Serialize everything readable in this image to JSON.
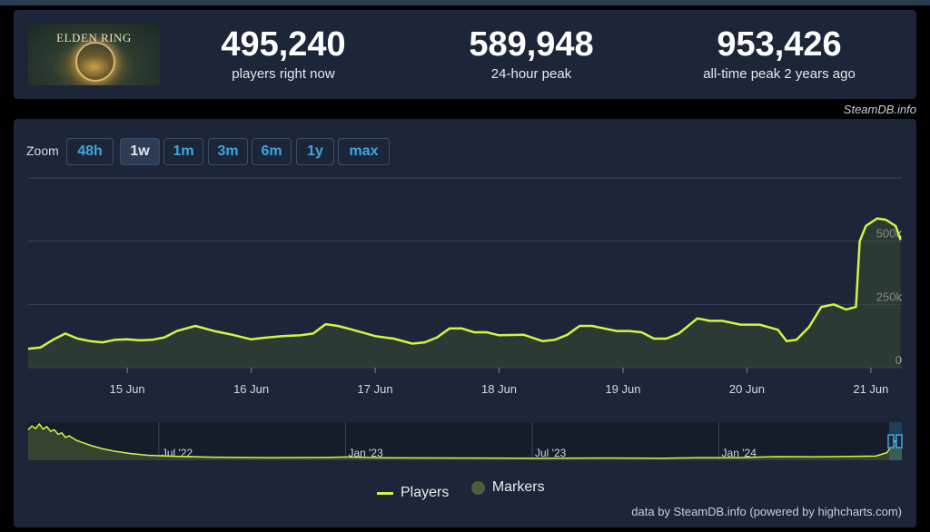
{
  "stats": {
    "current": {
      "value": "495,240",
      "label": "players right now"
    },
    "peak24": {
      "value": "589,948",
      "label": "24-hour peak"
    },
    "alltime": {
      "value": "953,426",
      "label": "all-time peak 2 years ago"
    }
  },
  "logo_text": "ELDEN RING",
  "credit_top": "SteamDB.info",
  "zoom": {
    "label": "Zoom",
    "options": [
      "48h",
      "1w",
      "1m",
      "3m",
      "6m",
      "1y",
      "max"
    ],
    "active": "1w"
  },
  "legend": {
    "players": "Players",
    "markers": "Markers"
  },
  "credit_bottom": "data by SteamDB.info (powered by highcharts.com)",
  "colors": {
    "line": "#d1f545",
    "card": "#1c2638",
    "accent": "#3ea6e0",
    "grid": "#36445a"
  },
  "chart_data": {
    "type": "area",
    "series": [
      {
        "name": "Players",
        "unit": "players"
      }
    ],
    "y_ticks": [
      "0",
      "250k",
      "500k"
    ],
    "y_values": [
      0,
      250000,
      500000
    ],
    "ylim": [
      0,
      750000
    ],
    "x_labels": [
      "15 Jun",
      "16 Jun",
      "17 Jun",
      "18 Jun",
      "19 Jun",
      "20 Jun",
      "21 Jun"
    ],
    "x_label_days": [
      15,
      16,
      17,
      18,
      19,
      20,
      21
    ],
    "xlim_days": [
      14.2,
      21.25
    ],
    "points": [
      [
        14.2,
        75000
      ],
      [
        14.3,
        80000
      ],
      [
        14.4,
        110000
      ],
      [
        14.5,
        135000
      ],
      [
        14.6,
        115000
      ],
      [
        14.7,
        105000
      ],
      [
        14.8,
        100000
      ],
      [
        14.9,
        110000
      ],
      [
        15.0,
        112000
      ],
      [
        15.1,
        108000
      ],
      [
        15.2,
        110000
      ],
      [
        15.3,
        120000
      ],
      [
        15.4,
        145000
      ],
      [
        15.55,
        165000
      ],
      [
        15.7,
        145000
      ],
      [
        15.85,
        130000
      ],
      [
        16.0,
        112000
      ],
      [
        16.1,
        118000
      ],
      [
        16.25,
        125000
      ],
      [
        16.4,
        128000
      ],
      [
        16.5,
        135000
      ],
      [
        16.6,
        172000
      ],
      [
        16.7,
        165000
      ],
      [
        16.8,
        152000
      ],
      [
        17.0,
        125000
      ],
      [
        17.15,
        115000
      ],
      [
        17.3,
        95000
      ],
      [
        17.4,
        100000
      ],
      [
        17.5,
        120000
      ],
      [
        17.6,
        155000
      ],
      [
        17.7,
        155000
      ],
      [
        17.8,
        140000
      ],
      [
        17.9,
        140000
      ],
      [
        18.0,
        128000
      ],
      [
        18.2,
        130000
      ],
      [
        18.35,
        105000
      ],
      [
        18.45,
        110000
      ],
      [
        18.55,
        130000
      ],
      [
        18.65,
        165000
      ],
      [
        18.75,
        165000
      ],
      [
        18.85,
        155000
      ],
      [
        18.95,
        145000
      ],
      [
        19.05,
        145000
      ],
      [
        19.15,
        140000
      ],
      [
        19.25,
        115000
      ],
      [
        19.35,
        115000
      ],
      [
        19.45,
        135000
      ],
      [
        19.6,
        195000
      ],
      [
        19.7,
        185000
      ],
      [
        19.8,
        185000
      ],
      [
        19.95,
        170000
      ],
      [
        20.1,
        170000
      ],
      [
        20.25,
        150000
      ],
      [
        20.32,
        105000
      ],
      [
        20.4,
        110000
      ],
      [
        20.5,
        160000
      ],
      [
        20.6,
        240000
      ],
      [
        20.7,
        250000
      ],
      [
        20.8,
        230000
      ],
      [
        20.88,
        240000
      ],
      [
        20.91,
        500000
      ],
      [
        20.96,
        560000
      ],
      [
        21.05,
        590000
      ],
      [
        21.12,
        585000
      ],
      [
        21.2,
        560000
      ],
      [
        21.24,
        505000
      ]
    ]
  },
  "navigator": {
    "labels": [
      "Jul '22",
      "Jan '23",
      "Jul '23",
      "Jan '24"
    ],
    "label_years": [
      2022.5,
      2023.0,
      2023.5,
      2024.0
    ],
    "xlim_years": [
      2022.15,
      2024.49
    ],
    "ylim": [
      0,
      1000000
    ],
    "points": [
      [
        2022.15,
        800000
      ],
      [
        2022.16,
        900000
      ],
      [
        2022.17,
        830000
      ],
      [
        2022.18,
        950000
      ],
      [
        2022.19,
        820000
      ],
      [
        2022.2,
        880000
      ],
      [
        2022.21,
        760000
      ],
      [
        2022.22,
        800000
      ],
      [
        2022.23,
        680000
      ],
      [
        2022.24,
        720000
      ],
      [
        2022.25,
        600000
      ],
      [
        2022.26,
        640000
      ],
      [
        2022.28,
        520000
      ],
      [
        2022.3,
        450000
      ],
      [
        2022.32,
        380000
      ],
      [
        2022.35,
        300000
      ],
      [
        2022.38,
        240000
      ],
      [
        2022.42,
        180000
      ],
      [
        2022.47,
        130000
      ],
      [
        2022.55,
        100000
      ],
      [
        2022.65,
        80000
      ],
      [
        2022.8,
        70000
      ],
      [
        2022.95,
        75000
      ],
      [
        2023.0,
        85000
      ],
      [
        2023.1,
        65000
      ],
      [
        2023.3,
        60000
      ],
      [
        2023.5,
        55000
      ],
      [
        2023.7,
        60000
      ],
      [
        2023.85,
        55000
      ],
      [
        2023.95,
        70000
      ],
      [
        2024.05,
        70000
      ],
      [
        2024.15,
        95000
      ],
      [
        2024.25,
        90000
      ],
      [
        2024.35,
        100000
      ],
      [
        2024.42,
        110000
      ],
      [
        2024.45,
        200000
      ],
      [
        2024.47,
        500000
      ],
      [
        2024.49,
        495000
      ]
    ]
  }
}
